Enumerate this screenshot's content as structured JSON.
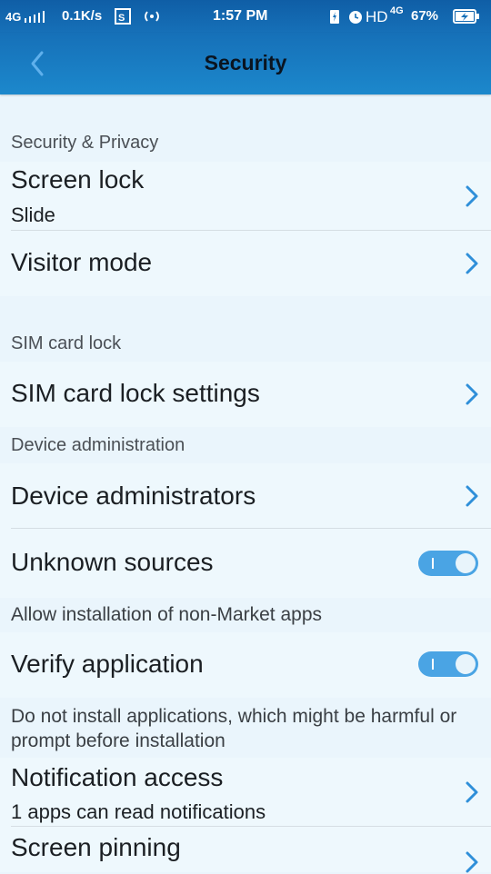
{
  "status_bar": {
    "network_left": "4G",
    "speed": "0.1K/s",
    "time": "1:57 PM",
    "hd": "HD",
    "network_right": "4G",
    "battery": "67%"
  },
  "header": {
    "title": "Security"
  },
  "sections": {
    "security_privacy": "Security & Privacy",
    "sim_card_lock": "SIM card lock",
    "device_admin": "Device administration"
  },
  "items": {
    "screen_lock": {
      "title": "Screen lock",
      "subtitle": "Slide"
    },
    "visitor_mode": {
      "title": "Visitor mode"
    },
    "sim_lock_settings": {
      "title": "SIM card lock settings"
    },
    "device_administrators": {
      "title": "Device administrators"
    },
    "unknown_sources": {
      "title": "Unknown sources",
      "enabled": true,
      "description": "Allow installation of non-Market apps"
    },
    "verify_application": {
      "title": "Verify application",
      "enabled": true,
      "description": "Do not install applications, which might be harmful or prompt before installation"
    },
    "notification_access": {
      "title": "Notification access",
      "subtitle": "1 apps can read notifications"
    },
    "screen_pinning": {
      "title": "Screen pinning"
    }
  },
  "icons": {
    "back": "chevron-left-icon",
    "chevron": "chevron-right-icon",
    "accent_color": "#4aa4e4",
    "header_color": "#1670b8"
  }
}
